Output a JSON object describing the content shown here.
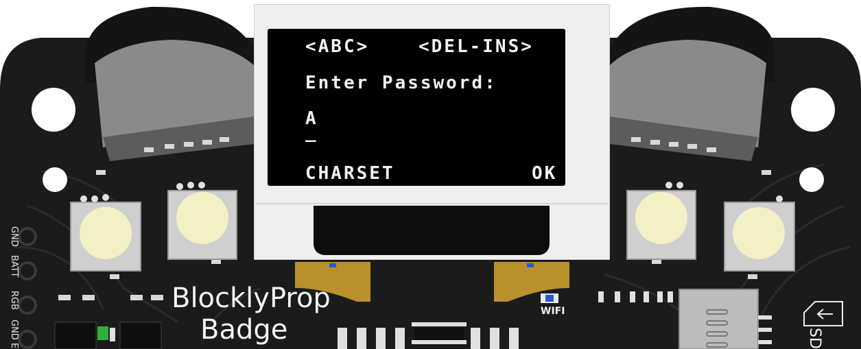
{
  "screen": {
    "line1_left": "<ABC>",
    "line1_right": "<DEL-INS>",
    "prompt": "Enter Password:",
    "input_value": "A",
    "cursor": "_",
    "softkey_left": "CHARSET",
    "softkey_right": "OK"
  },
  "silkscreen": {
    "brand_line1": "BlocklyProp",
    "brand_line2": "Badge",
    "wifi_label": "WIFI",
    "sd_label": "SD",
    "pin_labels": [
      "GND",
      "BATT",
      "RGB",
      "GND",
      "E"
    ]
  },
  "colors": {
    "pcb": "#1b1b1b",
    "pcb_trace": "#2a2a2a",
    "oled_frame": "#efefef",
    "oled_screen": "#000000",
    "oled_text": "#f2f2f2",
    "gold": "#b8902c",
    "led_glow": "#f3f0c6",
    "wifi_led": "#2a56d4",
    "power_led": "#2fae3a"
  }
}
